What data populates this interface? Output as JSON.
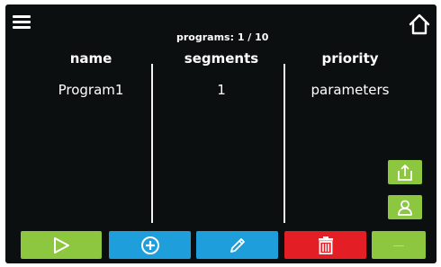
{
  "header": {
    "counter_text": "programs: 1 / 10",
    "menu_icon": "hamburger-menu-icon",
    "home_icon": "home-icon"
  },
  "table": {
    "columns": [
      "name",
      "segments",
      "priority"
    ],
    "rows": [
      {
        "name": "Program1",
        "segments": "1",
        "priority": "parameters"
      }
    ]
  },
  "side_buttons": [
    {
      "icon": "export-icon"
    },
    {
      "icon": "user-icon"
    }
  ],
  "bottom_buttons": [
    {
      "icon": "play-icon",
      "color": "#8dc63f"
    },
    {
      "icon": "add-circle-icon",
      "color": "#1e9fdc"
    },
    {
      "icon": "pencil-icon",
      "color": "#1e9fdc"
    },
    {
      "icon": "trash-icon",
      "color": "#e31e24"
    },
    {
      "icon": "dots-icon",
      "color": "#8dc63f"
    }
  ],
  "colors": {
    "background": "#0c0f10",
    "green": "#8dc63f",
    "blue": "#1e9fdc",
    "red": "#e31e24",
    "text": "#ffffff"
  }
}
